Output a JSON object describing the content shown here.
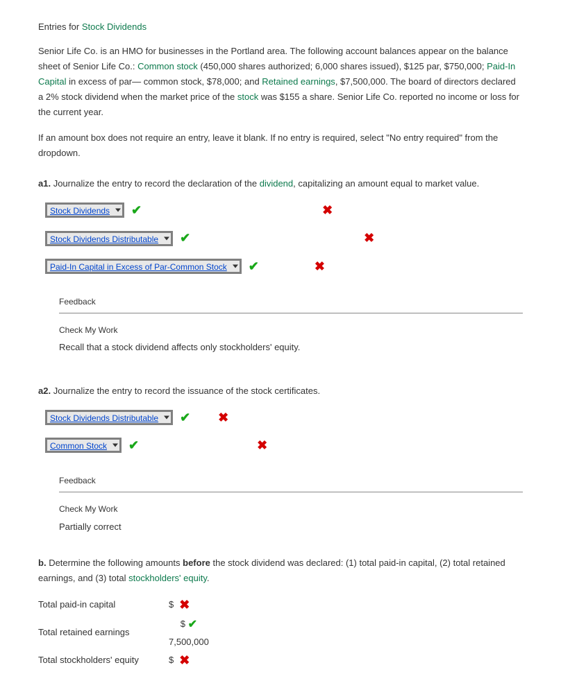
{
  "header": {
    "entries_for": "Entries for",
    "entries_link": "Stock Dividends"
  },
  "intro": {
    "p1a": "Senior Life Co. is an HMO for businesses in the Portland area. The following account balances appear on the balance sheet of Senior Life Co.: ",
    "p1_link1": "Common stock",
    "p1b": " (450,000 shares authorized; 6,000 shares issued), $125 par, $750,000; ",
    "p1_link2": "Paid-In Capital",
    "p1c": " in excess of par— common stock, $78,000; and ",
    "p1_link3": "Retained earnings",
    "p1d": ", $7,500,000. The board of directors declared a 2% stock dividend when the market price of the ",
    "p1_link4": "stock",
    "p1e": " was $155 a share. Senior Life Co. reported no income or loss for the current year.",
    "p2": "If an amount box does not require an entry, leave it blank. If no entry is required, select \"No entry required\" from the dropdown."
  },
  "a1": {
    "label": "a1.",
    "text_a": "Journalize the entry to record the declaration of the ",
    "text_link": "dividend",
    "text_b": ", capitalizing an amount equal to market value.",
    "rows": [
      {
        "select": "Stock Dividends",
        "left_mark": "check",
        "right_mark": "cross"
      },
      {
        "select": "Stock Dividends Distributable",
        "left_mark": "check",
        "right_mark": "cross"
      },
      {
        "select": "Paid-In Capital in Excess of Par-Common Stock",
        "left_mark": "check",
        "right_mark": "cross"
      }
    ],
    "feedback": {
      "title": "Feedback",
      "sub": "Check My Work",
      "text": "Recall that a stock dividend affects only stockholders' equity."
    }
  },
  "a2": {
    "label": "a2.",
    "text": "Journalize the entry to record the issuance of the stock certificates.",
    "rows": [
      {
        "select": "Stock Dividends Distributable",
        "left_mark": "check",
        "right_mark": "cross"
      },
      {
        "select": "Common Stock",
        "left_mark": "check",
        "right_mark": "cross"
      }
    ],
    "feedback": {
      "title": "Feedback",
      "sub": "Check My Work",
      "text": "Partially correct"
    }
  },
  "b": {
    "label": "b.",
    "text_a": "Determine the following amounts ",
    "text_bold": "before",
    "text_b": " the stock dividend was declared: (1) total paid-in capital, (2) total retained earnings, and (3) total ",
    "text_link": "stockholders' equity",
    "text_c": ".",
    "rows": [
      {
        "label": "Total paid-in capital",
        "currency": "$",
        "value": "",
        "mark": "cross"
      },
      {
        "label": "Total retained earnings",
        "currency": "$",
        "value": "7,500,000",
        "mark": "check"
      },
      {
        "label": "Total stockholders' equity",
        "currency": "$",
        "value": "",
        "mark": "cross"
      }
    ]
  }
}
